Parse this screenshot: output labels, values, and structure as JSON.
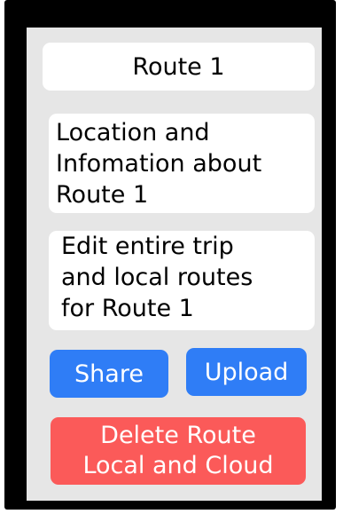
{
  "route": {
    "title": "Route 1",
    "info_lines": [
      "Location and",
      "Infomation about",
      "Route 1"
    ],
    "edit_lines": [
      "Edit entire trip",
      "and local routes",
      "for Route 1"
    ]
  },
  "actions": {
    "share_label": "Share",
    "upload_label": "Upload",
    "delete_lines": [
      "Delete Route",
      "Local and Cloud"
    ]
  },
  "colors": {
    "frame": "#000000",
    "screen_background": "#e6e6e6",
    "card_background": "#ffffff",
    "primary_button": "#2f7df6",
    "danger_button": "#fb5a59"
  }
}
